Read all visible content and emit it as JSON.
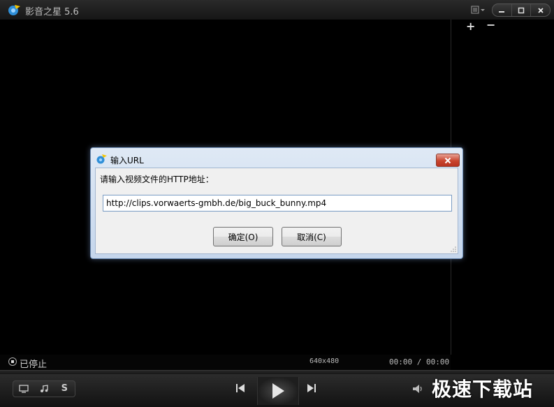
{
  "app": {
    "title": "影音之星 5.6"
  },
  "window_controls": {
    "menu": "menu-icon",
    "minimize": "minimize-icon",
    "maximize": "maximize-icon",
    "close": "close-icon"
  },
  "playlist": {
    "add_label": "+",
    "remove_label": "−"
  },
  "status": {
    "state": "已停止",
    "resolution": "640x480",
    "time": "00:00 / 00:00"
  },
  "controls": {
    "subtitle_label": "S",
    "watermark": "极速下载站"
  },
  "dialog": {
    "title": "输入URL",
    "prompt": "请输入视频文件的HTTP地址：",
    "url_value": "http://clips.vorwaerts-gmbh.de/big_buck_bunny.mp4",
    "ok_label": "确定(O)",
    "cancel_label": "取消(C)"
  },
  "colors": {
    "dialog_frame": "#c5d6ec",
    "close_red": "#c9452f",
    "background": "#000000"
  }
}
